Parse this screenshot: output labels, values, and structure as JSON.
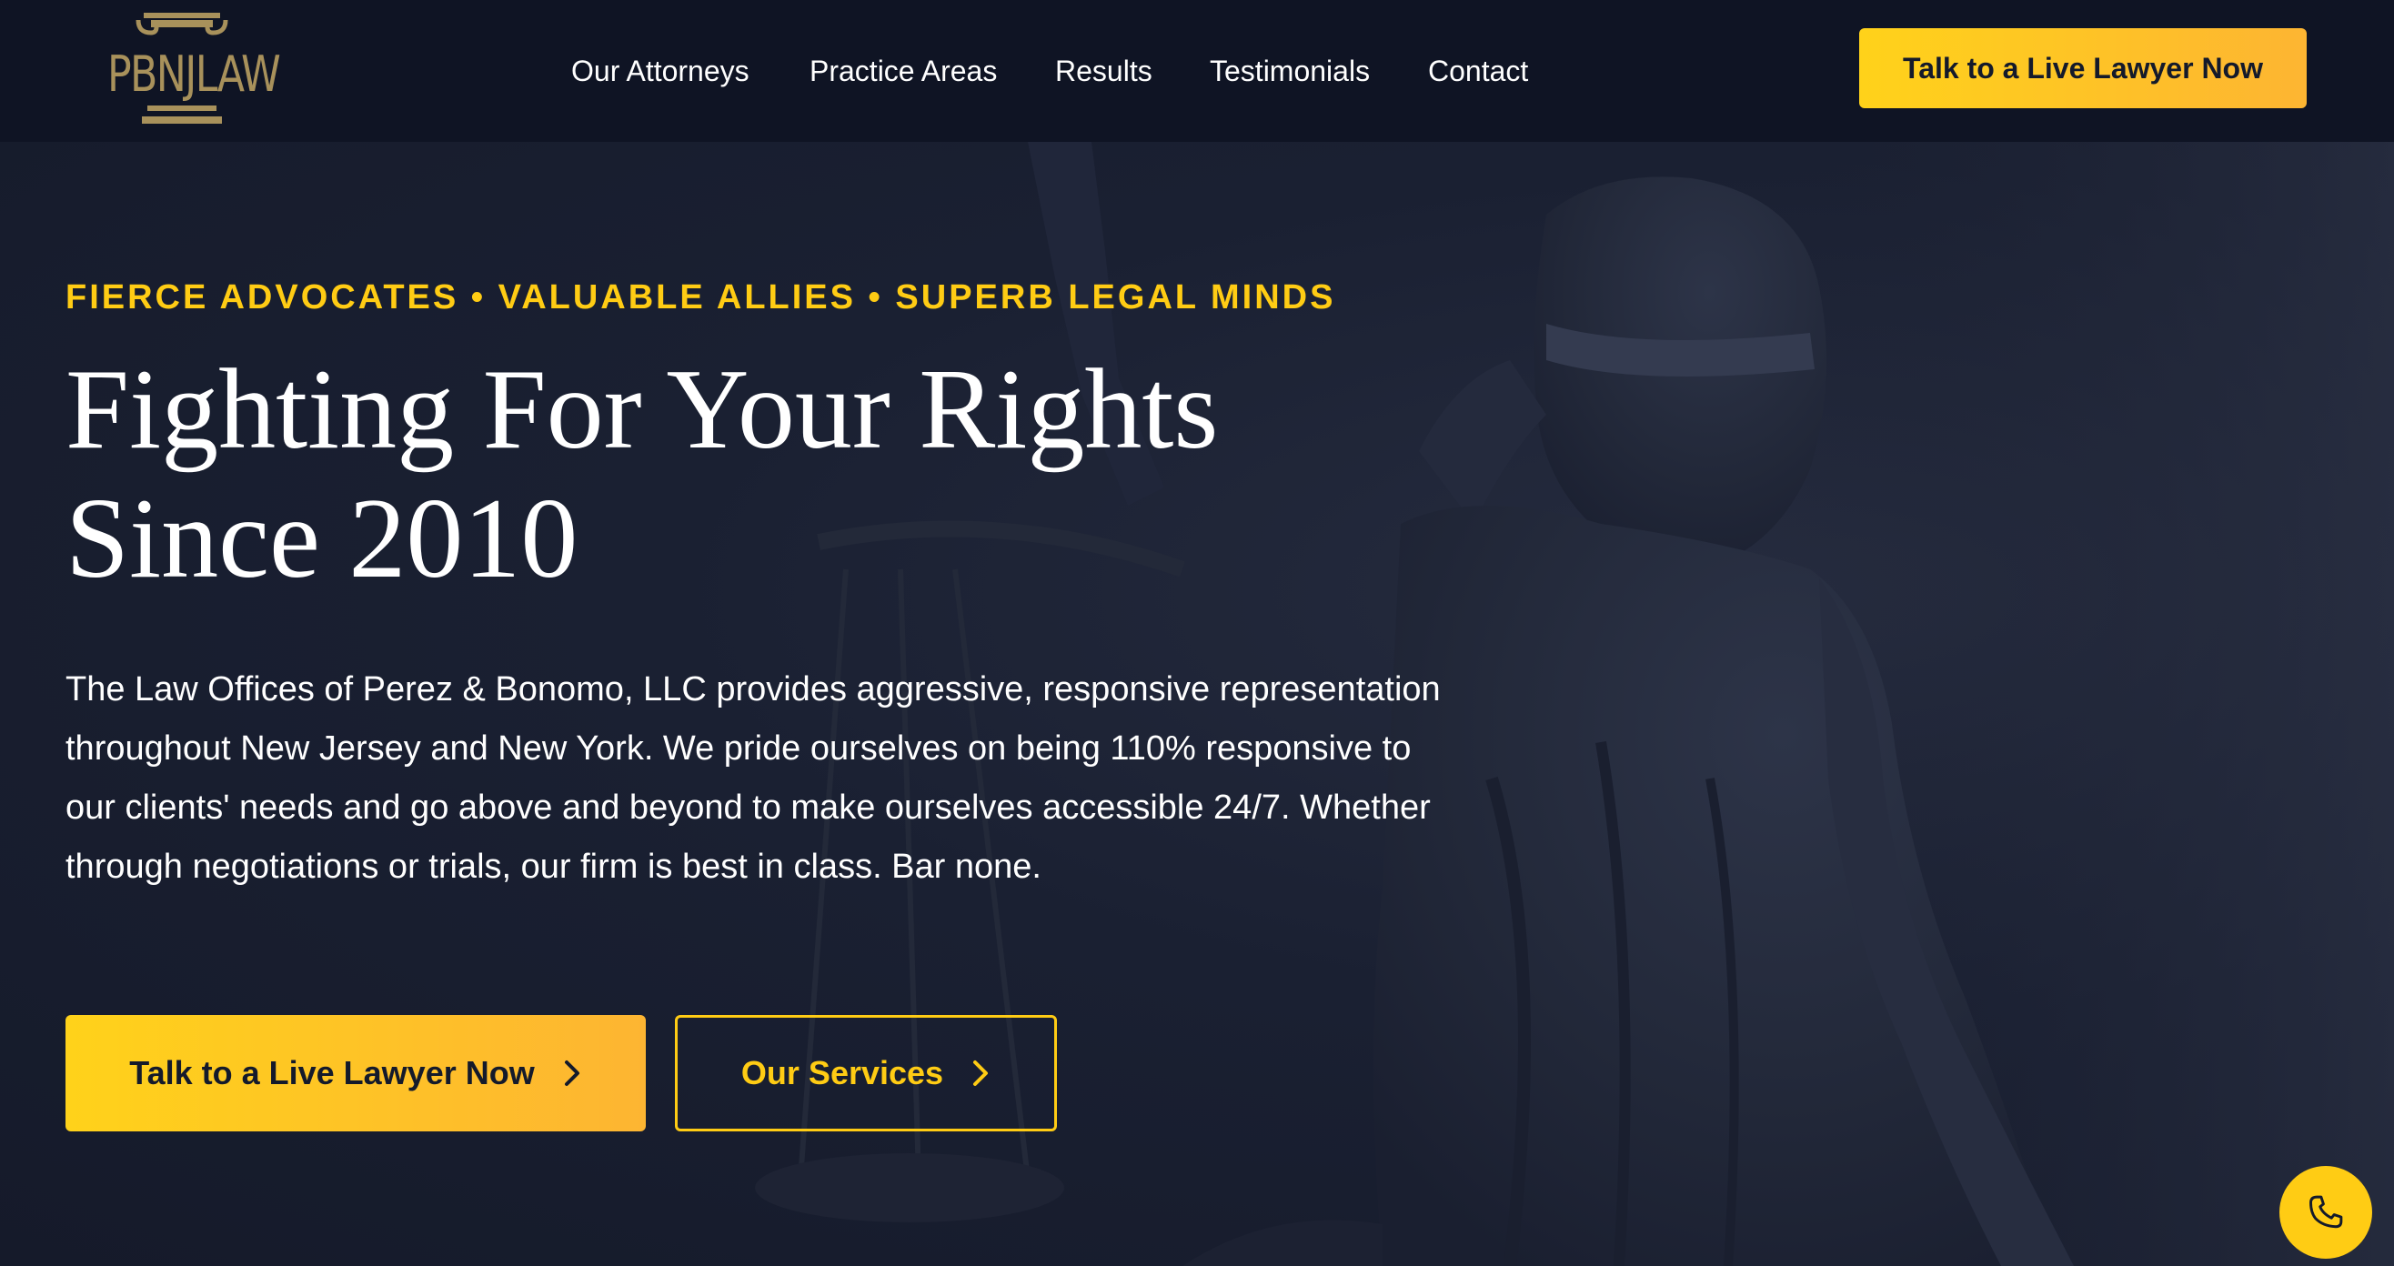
{
  "header": {
    "logo_text": "PBNJLAW",
    "nav": [
      {
        "label": "Our Attorneys"
      },
      {
        "label": "Practice Areas"
      },
      {
        "label": "Results"
      },
      {
        "label": "Testimonials"
      },
      {
        "label": "Contact"
      }
    ],
    "cta_label": "Talk to a Live Lawyer Now"
  },
  "hero": {
    "tagline": "FIERCE ADVOCATES • VALUABLE ALLIES • SUPERB LEGAL MINDS",
    "headline_line1": "Fighting For Your Rights",
    "headline_line2": "Since 2010",
    "description": "The Law Offices of Perez & Bonomo, LLC provides aggressive, responsive representation throughout New Jersey and New York. We pride ourselves on being 110% responsive to our clients' needs and go above and beyond to make ourselves accessible 24/7. Whether through negotiations or trials, our firm is best in class. Bar none.",
    "primary_button": "Talk to a Live Lawyer Now",
    "secondary_button": "Our Services"
  },
  "floating": {
    "phone_icon": "phone-icon"
  },
  "colors": {
    "accent": "#ffcc14",
    "accent_gradient_end": "#fdb532",
    "header_bg": "#0f1424",
    "hero_bg": "#161b2c",
    "logo_gold": "#a8915b"
  }
}
